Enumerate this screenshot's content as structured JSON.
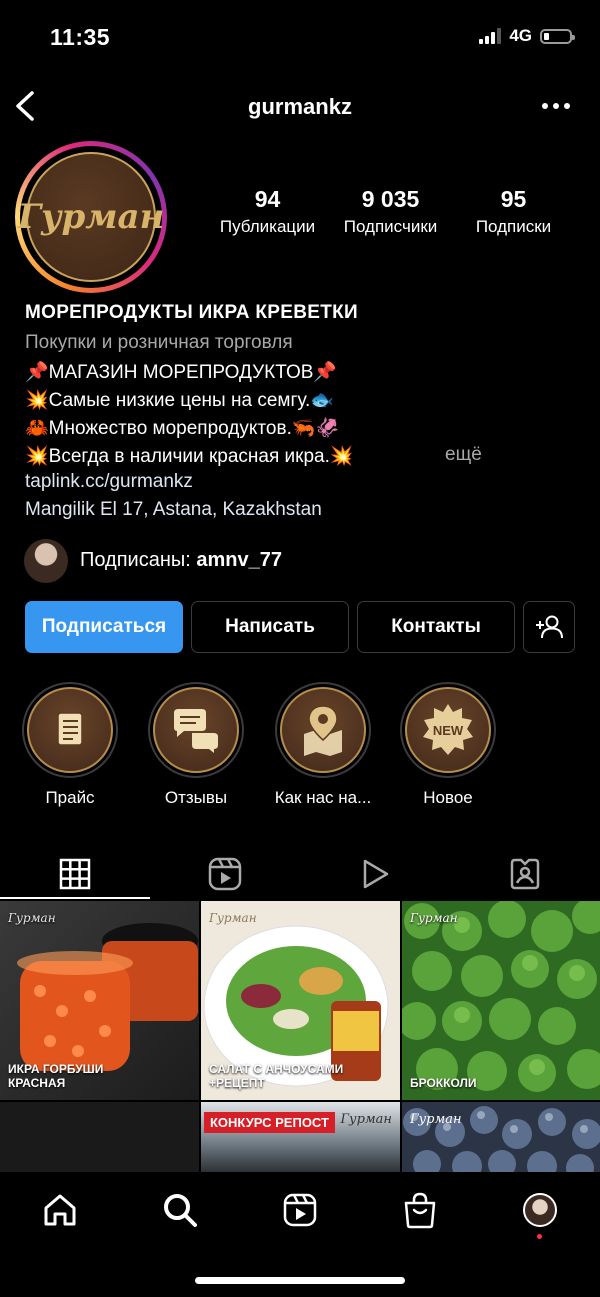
{
  "status_bar": {
    "time": "11:35",
    "network": "4G"
  },
  "header": {
    "username": "gurmankz"
  },
  "profile": {
    "avatar_text": "Гурман",
    "stats": [
      {
        "value": "94",
        "label": "Публикации"
      },
      {
        "value": "9 035",
        "label": "Подписчики"
      },
      {
        "value": "95",
        "label": "Подписки"
      }
    ],
    "name": "МОРЕПРОДУКТЫ ИКРА КРЕВЕТКИ",
    "category": "Покупки и розничная торговля",
    "bio_lines": [
      "📌МАГАЗИН МОРЕПРОДУКТОВ📌",
      "💥Самые низкие цены на семгу.🐟",
      "🦀Множество морепродуктов.🦐🦑",
      "💥Всегда в наличии красная икра.💥"
    ],
    "more_label": "ещё",
    "link": "taplink.cc/gurmankz",
    "address": "Mangilik El 17, Astana, Kazakhstan",
    "followed_by_prefix": "Подписаны: ",
    "followed_by_user": "amnv_77"
  },
  "actions": {
    "follow": "Подписаться",
    "message": "Написать",
    "contacts": "Контакты"
  },
  "highlights": [
    {
      "label": "Прайс",
      "icon": "price-list-icon"
    },
    {
      "label": "Отзывы",
      "icon": "chat-bubbles-icon"
    },
    {
      "label": "Как нас на...",
      "icon": "map-pin-icon"
    },
    {
      "label": "Новое",
      "icon": "new-badge-icon",
      "badge": "NEW"
    }
  ],
  "tabs": [
    "grid-icon",
    "reels-icon",
    "video-icon",
    "tagged-icon"
  ],
  "posts": [
    {
      "caption": "ИКРА ГОРБУШИ\nКРАСНАЯ",
      "brand": "Гурман"
    },
    {
      "caption": "САЛАТ С АНЧОУСАМИ\n+РЕЦЕПТ",
      "brand": "Гурман"
    },
    {
      "caption": "БРОККОЛИ",
      "brand": "Гурман"
    },
    {
      "caption": "",
      "brand": ""
    },
    {
      "caption": "КОНКУРС РЕПОСТ",
      "brand": "Гурман"
    },
    {
      "caption": "",
      "brand": "Гурман"
    }
  ],
  "bottom_nav": [
    "home-icon",
    "search-icon",
    "reels-icon",
    "shop-icon",
    "profile-avatar"
  ],
  "colors": {
    "primary": "#3797f0",
    "gold": "#c9a35b",
    "brown": "#4a2f1c"
  }
}
